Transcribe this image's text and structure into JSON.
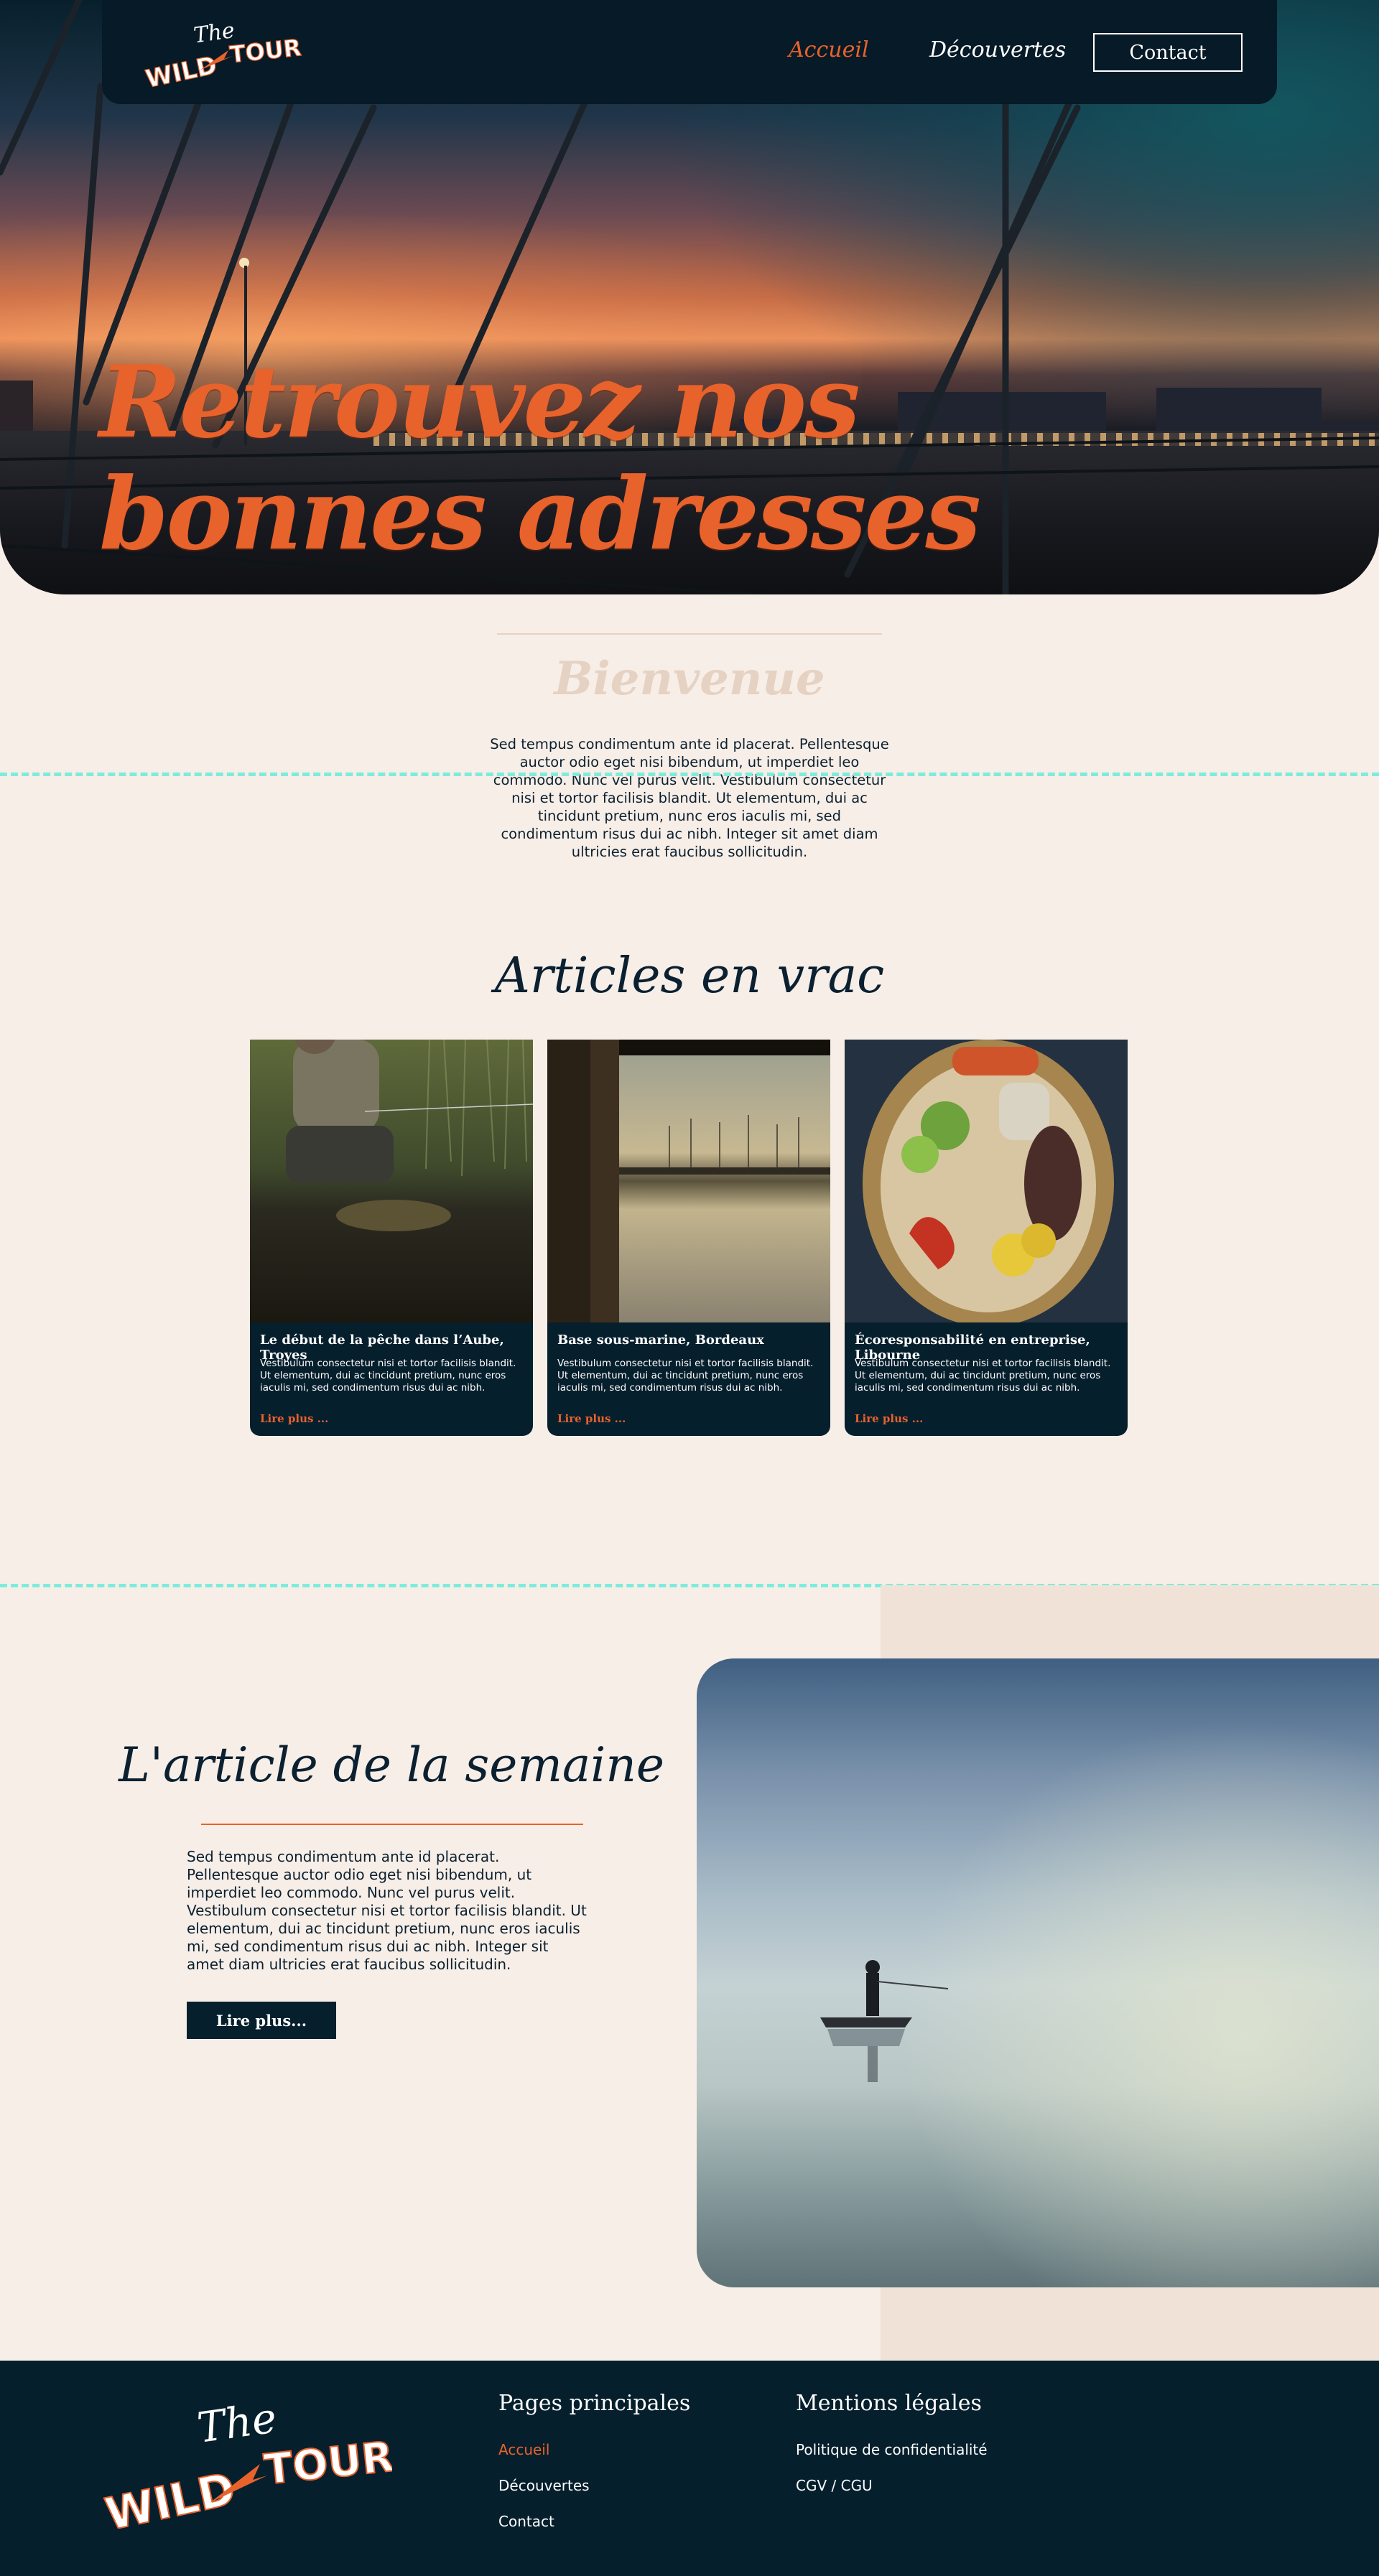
{
  "nav": {
    "logo": {
      "small": "The",
      "left": "WILD",
      "right": "TOUR"
    },
    "links": [
      {
        "label": "Accueil",
        "active": true
      },
      {
        "label": "Découvertes",
        "active": false
      }
    ],
    "contact_label": "Contact"
  },
  "hero": {
    "line1": "Retrouvez nos",
    "line2": "bonnes adresses"
  },
  "welcome": {
    "title": "Bienvenue",
    "text": "Sed tempus condimentum ante id placerat. Pellentesque auctor odio eget nisi bibendum, ut imperdiet leo commodo. Nunc vel purus velit. Vestibulum consectetur nisi et tortor facilisis blandit. Ut elementum, dui ac tincidunt pretium, nunc eros iaculis mi, sed condimentum risus dui ac nibh. Integer sit amet diam ultricies erat faucibus sollicitudin."
  },
  "articles": {
    "title": "Articles en vrac",
    "cards": [
      {
        "title": "Le début de la pêche dans l’Aube, Troyes",
        "text": "Vestibulum consectetur nisi et tortor facilisis blandit. Ut elementum, dui ac tincidunt pretium, nunc eros iaculis mi, sed condimentum risus dui ac nibh.",
        "more": "Lire plus ..."
      },
      {
        "title": "Base sous-marine, Bordeaux",
        "text": "Vestibulum consectetur nisi et tortor facilisis blandit. Ut elementum, dui ac tincidunt pretium, nunc eros iaculis mi, sed condimentum risus dui ac nibh.",
        "more": "Lire plus ..."
      },
      {
        "title": "Écoresponsabilité en entreprise, Libourne",
        "text": "Vestibulum consectetur nisi et tortor facilisis blandit. Ut elementum, dui ac tincidunt pretium, nunc eros iaculis mi, sed condimentum risus dui ac nibh.",
        "more": "Lire plus ..."
      }
    ]
  },
  "week": {
    "title": "L'article de la semaine",
    "text": "Sed tempus condimentum ante id placerat. Pellentesque auctor odio eget nisi bibendum, ut imperdiet leo commodo. Nunc vel purus velit. Vestibulum consectetur nisi et tortor facilisis blandit. Ut elementum, dui ac tincidunt pretium, nunc eros iaculis mi, sed condimentum risus dui ac nibh. Integer sit amet diam ultricies erat faucibus sollicitudin.",
    "button": "Lire plus..."
  },
  "footer": {
    "col1": {
      "title": "Pages principales",
      "links": [
        {
          "label": "Accueil",
          "active": true
        },
        {
          "label": "Découvertes",
          "active": false
        },
        {
          "label": "Contact",
          "active": false
        }
      ]
    },
    "col2": {
      "title": "Mentions légales",
      "links": [
        {
          "label": "Politique de confidentialité"
        },
        {
          "label": "CGV / CGU"
        }
      ]
    }
  },
  "colors": {
    "accent": "#e8622c",
    "navy": "#061f2d",
    "cream": "#f7eee7",
    "dashed": "#7eecdc"
  }
}
